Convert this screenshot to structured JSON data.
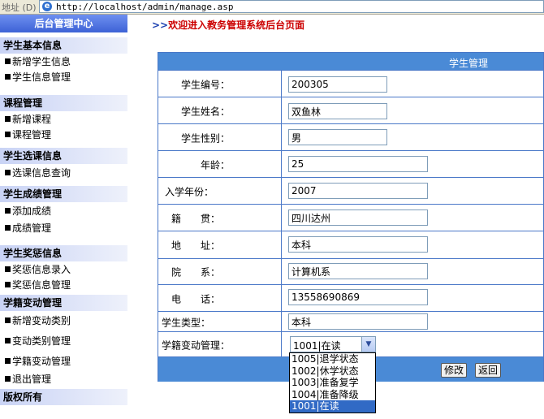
{
  "address_bar": {
    "label": "地址 (D)",
    "url": "http://localhost/admin/manage.asp"
  },
  "sidebar": {
    "header": "后台管理中心",
    "sections": [
      {
        "title": "学生基本信息",
        "items": [
          "新增学生信息",
          "学生信息管理"
        ]
      },
      {
        "title": "课程管理",
        "items": [
          "新增课程",
          "课程管理"
        ]
      },
      {
        "title": "学生选课信息",
        "items": [
          "选课信息查询"
        ]
      },
      {
        "title": "学生成绩管理",
        "items": [
          "添加成绩",
          "成绩管理"
        ]
      },
      {
        "title": "学生奖惩信息",
        "items": [
          "奖惩信息录入",
          "奖惩信息管理"
        ]
      },
      {
        "title": "学籍变动管理",
        "items": [
          "新增变动类别",
          "变动类别管理",
          "学籍变动管理",
          "退出管理"
        ]
      },
      {
        "title": "版权所有",
        "items": []
      }
    ]
  },
  "welcome": {
    "arrow": ">>",
    "text": "欢迎进入教务管理系统后台页面"
  },
  "form": {
    "title": "学生管理",
    "fields": [
      {
        "label": "学生编号：",
        "value": "200305"
      },
      {
        "label": "学生姓名：",
        "value": "双鱼林"
      },
      {
        "label": "学生性别：",
        "value": "男"
      },
      {
        "label": "年龄：",
        "value": "25"
      },
      {
        "label": "入学年份：",
        "value": "2007"
      },
      {
        "label": "籍　　贯：",
        "value": "四川达州"
      },
      {
        "label": "地　　址：",
        "value": "本科"
      },
      {
        "label": "院　　系：",
        "value": "计算机系"
      },
      {
        "label": "电　　话：",
        "value": "13558690869"
      },
      {
        "label": "学生类型：",
        "value": "本科"
      }
    ],
    "status_label": "学籍变动管理：",
    "status_selected": "1001|在读",
    "modify_button": "修改",
    "back_button": "返回"
  },
  "dropdown_options": [
    "1005|退学状态",
    "1002|休学状态",
    "1003|准备复学",
    "1004|准备降级",
    "1001|在读"
  ]
}
